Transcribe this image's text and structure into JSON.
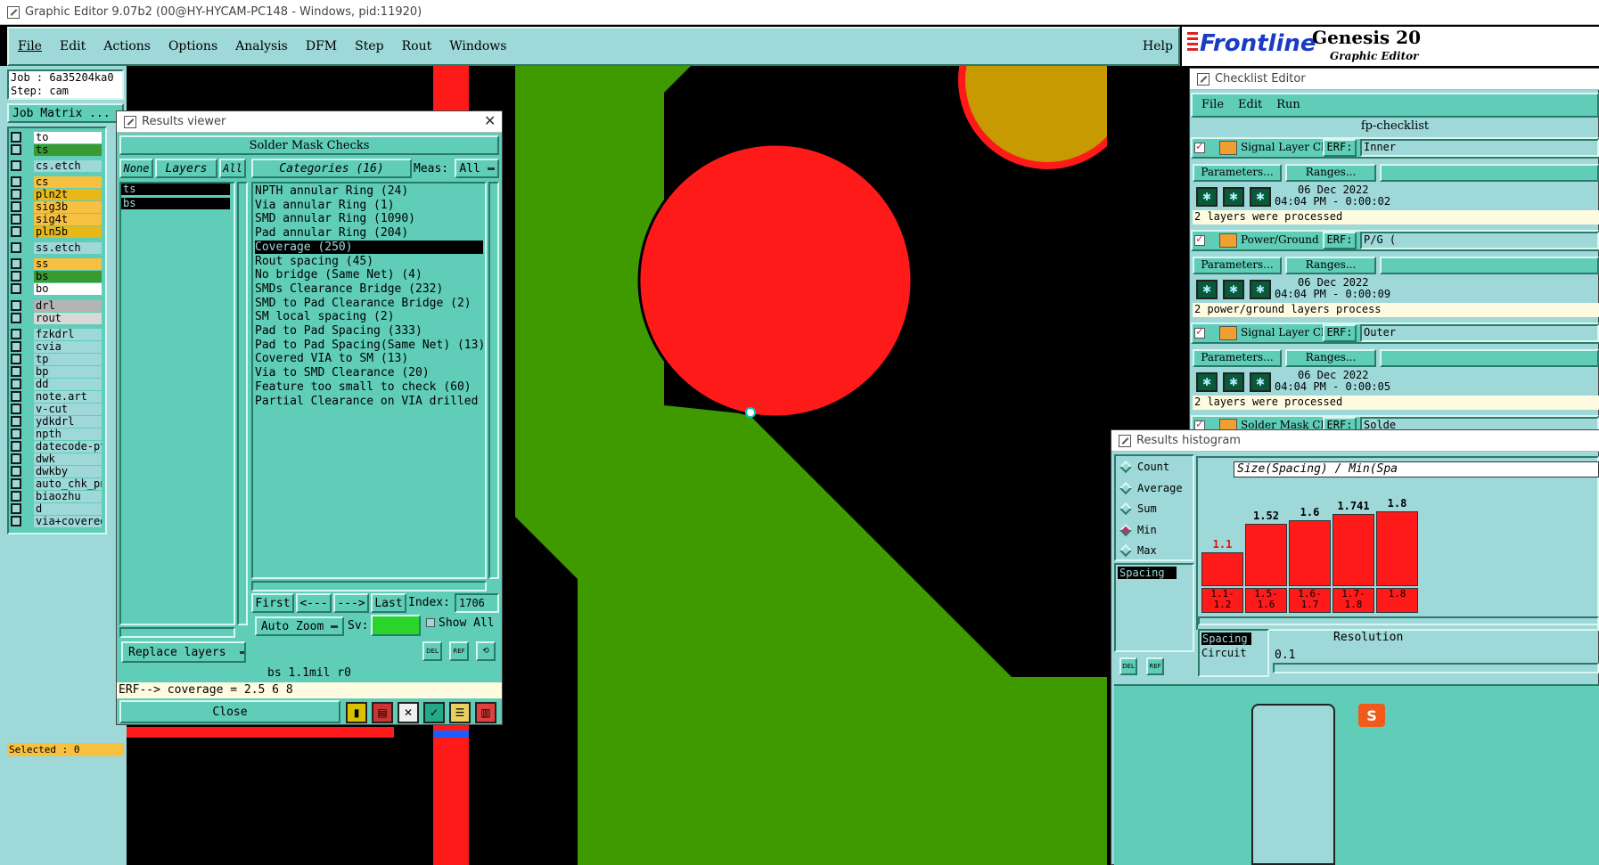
{
  "app": {
    "window_title": "Graphic Editor 9.07b2 (00@HY-HYCAM-PC148 - Windows, pid:11920)",
    "menu": [
      "File",
      "Edit",
      "Actions",
      "Options",
      "Analysis",
      "DFM",
      "Step",
      "Rout",
      "Windows"
    ],
    "help": "Help",
    "brand_logo": "Frontline",
    "brand_title": "Genesis 20",
    "brand_subtitle": "Graphic Editor"
  },
  "left_panel": {
    "job": "Job : 6a35204ka0",
    "step": "Step: cam",
    "job_matrix": "Job Matrix ...",
    "layers": [
      {
        "name": "to",
        "color": "#ffffff"
      },
      {
        "name": "ts",
        "color": "#3a9a32"
      },
      {
        "name": "cs.etch",
        "color": "#9ed8d8"
      },
      {
        "name": "cs",
        "color": "#f7c040"
      },
      {
        "name": "pln2t",
        "color": "#e8b818"
      },
      {
        "name": "sig3b",
        "color": "#f7c040"
      },
      {
        "name": "sig4t",
        "color": "#f7c040"
      },
      {
        "name": "pln5b",
        "color": "#e8b818"
      },
      {
        "name": "ss.etch",
        "color": "#9ed8d8"
      },
      {
        "name": "ss",
        "color": "#f7c040"
      },
      {
        "name": "bs",
        "color": "#3a9a32"
      },
      {
        "name": "bo",
        "color": "#ffffff"
      },
      {
        "name": "drl",
        "color": "#b4b4b4"
      },
      {
        "name": "rout",
        "color": "#d8d8d8"
      },
      {
        "name": "fzkdrl",
        "color": "#9ed8d8"
      },
      {
        "name": "cvia",
        "color": "#9ed8d8"
      },
      {
        "name": "tp",
        "color": "#9ed8d8"
      },
      {
        "name": "bp",
        "color": "#9ed8d8"
      },
      {
        "name": "dd",
        "color": "#9ed8d8"
      },
      {
        "name": "note.art",
        "color": "#9ed8d8"
      },
      {
        "name": "v-cut",
        "color": "#9ed8d8"
      },
      {
        "name": "ydkdrl",
        "color": "#9ed8d8"
      },
      {
        "name": "npth",
        "color": "#9ed8d8"
      },
      {
        "name": "datecode-pte",
        "color": "#9ed8d8"
      },
      {
        "name": "dwk",
        "color": "#9ed8d8"
      },
      {
        "name": "dwkby",
        "color": "#9ed8d8"
      },
      {
        "name": "auto_chk_pn",
        "color": "#9ed8d8"
      },
      {
        "name": "biaozhu",
        "color": "#9ed8d8"
      },
      {
        "name": "d",
        "color": "#9ed8d8"
      },
      {
        "name": "via+covered",
        "color": "#9ed8d8"
      }
    ],
    "selected": "Selected : 0"
  },
  "results_viewer": {
    "title": "Results viewer",
    "header": "Solder Mask Checks",
    "btn_none": "None",
    "btn_layers": "Layers",
    "btn_all": "All",
    "categories_label": "Categories (16)",
    "meas_label": "Meas:",
    "meas_value": "All",
    "layers": [
      "ts",
      "bs"
    ],
    "categories": [
      "NPTH annular Ring (24)",
      "Via annular Ring (1)",
      "SMD annular Ring (1090)",
      "Pad annular Ring (204)",
      "Coverage (250)",
      "Rout spacing (45)",
      "No bridge (Same Net) (4)",
      "SMDs Clearance Bridge (232)",
      "SMD to Pad Clearance Bridge (2)",
      "SM local spacing (2)",
      "Pad to Pad Spacing (333)",
      "Pad to Pad Spacing(Same Net) (13)",
      "Covered VIA to SM (13)",
      "Via to SMD Clearance (20)",
      "Feature too small to check (60)",
      "Partial Clearance on VIA drilled"
    ],
    "selected_category": "Coverage (250)",
    "nav_first": "First",
    "nav_prev": "<---",
    "nav_next": "--->",
    "nav_last": "Last",
    "index_label": "Index:",
    "index_value": "1706",
    "auto_zoom": "Auto Zoom",
    "sv_label": "Sv:",
    "show_all": "Show All",
    "replace_layers": "Replace layers",
    "del_label": "DEL",
    "ref_label": "REF",
    "info_line": "bs 1.1mil r0",
    "erf_line": "ERF--> coverage = 2.5 6 8",
    "close": "Close"
  },
  "checklist_editor": {
    "title": "Checklist Editor",
    "menu": [
      "File",
      "Edit",
      "Run"
    ],
    "name": "fp-checklist",
    "checks": [
      {
        "name": "Signal Layer Ch",
        "erf": "ERF:",
        "erf_value": "Inner",
        "date": "06 Dec 2022",
        "time": "04:04 PM - 0:00:02",
        "status": "2 layers were processed"
      },
      {
        "name": "Power/Ground C",
        "erf": "ERF:",
        "erf_value": "P/G (",
        "date": "06 Dec 2022",
        "time": "04:04 PM - 0:00:09",
        "status": "2 power/ground layers process"
      },
      {
        "name": "Signal Layer Ch",
        "erf": "ERF:",
        "erf_value": "Outer",
        "date": "06 Dec 2022",
        "time": "04:04 PM - 0:00:05",
        "status": "2 layers were processed"
      },
      {
        "name": "Solder Mask Ch",
        "erf": "ERF:",
        "erf_value": "Solde",
        "date": "",
        "time": "",
        "status": ""
      }
    ],
    "params": "Parameters...",
    "ranges": "Ranges..."
  },
  "histogram": {
    "title": "Results histogram",
    "modes": [
      "Count",
      "Average",
      "Sum",
      "Min",
      "Max"
    ],
    "selected_mode": "Min",
    "list": [
      "Spacing"
    ],
    "chart_title": "Size(Spacing) / Min(Spa",
    "bars": [
      {
        "value": "1.1",
        "label": "1.1-\n1.2",
        "level": 0.4
      },
      {
        "value": "1.52",
        "label": "1.5-\n1.6",
        "level": 0.73
      },
      {
        "value": "1.6",
        "label": "1.6-\n1.7",
        "level": 0.77
      },
      {
        "value": "1.741",
        "label": "1.7-\n1.8",
        "level": 0.84
      },
      {
        "value": "1.8",
        "label": "1.8",
        "level": 0.87
      }
    ],
    "categories": [
      "Spacing",
      "Circuit"
    ],
    "resolution_label": "Resolution",
    "resolution_value": "0.1",
    "del_label": "DEL",
    "ref_label": "REF"
  }
}
